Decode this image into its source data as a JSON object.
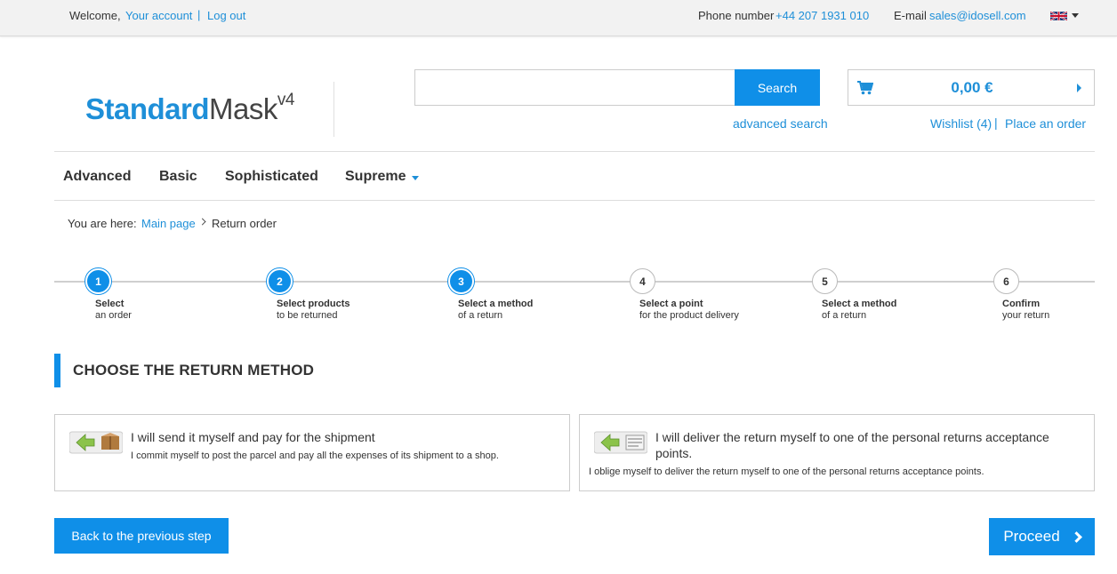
{
  "topbar": {
    "welcome": "Welcome,",
    "your_account": "Your account",
    "separator": "|",
    "log_out": "Log out",
    "phone_label": "Phone number",
    "phone": "+44 207 1931 010",
    "email_label": "E-mail",
    "email": "sales@idosell.com",
    "language_icon": "uk-flag-icon"
  },
  "logo": {
    "part1": "Standard",
    "part2": "Mask",
    "version": "v4"
  },
  "search": {
    "placeholder": "",
    "button": "Search",
    "advanced": "advanced search"
  },
  "cart": {
    "total": "0,00 €",
    "wishlist": "Wishlist (4)",
    "separator": "|",
    "place_order": "Place an order"
  },
  "menu": {
    "items": [
      {
        "label": "Advanced"
      },
      {
        "label": "Basic"
      },
      {
        "label": "Sophisticated"
      },
      {
        "label": "Supreme"
      }
    ]
  },
  "breadcrumb": {
    "label": "You are here:",
    "main": "Main page",
    "current": "Return order"
  },
  "steps": [
    {
      "number": "1",
      "title": "Select",
      "subtitle": "an order",
      "active": true
    },
    {
      "number": "2",
      "title": "Select products",
      "subtitle": "to be returned",
      "active": true
    },
    {
      "number": "3",
      "title": "Select a method",
      "subtitle": "of a return",
      "active": true
    },
    {
      "number": "4",
      "title": "Select a point",
      "subtitle": "for the product delivery",
      "active": false
    },
    {
      "number": "5",
      "title": "Select a method",
      "subtitle": "of a return",
      "active": false
    },
    {
      "number": "6",
      "title": "Confirm",
      "subtitle": "your return",
      "active": false
    }
  ],
  "section": {
    "title": "CHOOSE THE RETURN METHOD"
  },
  "options": [
    {
      "title": "I will send it myself and pay for the shipment",
      "description": "I commit myself to post the parcel and pay all the expenses of its shipment to a shop."
    },
    {
      "title": "I will deliver the return myself to one of the personal returns acceptance points.",
      "description": "I oblige myself to deliver the return myself to one of the personal returns acceptance points."
    }
  ],
  "buttons": {
    "back": "Back to the previous step",
    "proceed": "Proceed"
  },
  "colors": {
    "accent": "#0f8fe8",
    "link": "#1e8fd8"
  }
}
